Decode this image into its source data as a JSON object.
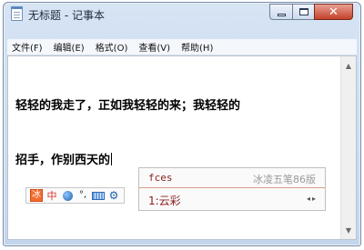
{
  "window": {
    "title": "无标题 - 记事本",
    "close_glyph": "✕"
  },
  "menubar": {
    "items": [
      "文件(F)",
      "编辑(E)",
      "格式(O)",
      "查看(V)",
      "帮助(H)"
    ]
  },
  "editor": {
    "lines": [
      "轻轻的我走了，正如我轻轻的来；我轻轻的",
      "招手，作别西天的"
    ]
  },
  "ime": {
    "status": {
      "mode": "冰",
      "half_width": "中",
      "punct": "°,"
    },
    "candidate": {
      "input": "fces",
      "ime_name": "冰凌五笔86版",
      "item": "1:云彩",
      "nav": "◂▸"
    }
  },
  "scrollbar": {
    "up": "▲",
    "down": "▼"
  }
}
